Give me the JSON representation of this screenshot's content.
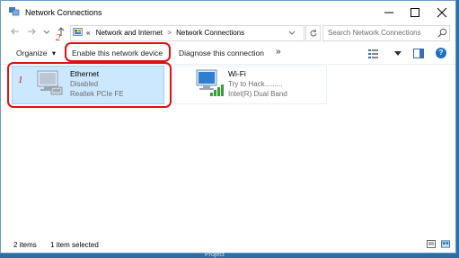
{
  "window": {
    "title": "Network Connections",
    "controls": {
      "minimize": "minimize-icon",
      "maximize": "maximize-icon",
      "close": "close-icon"
    }
  },
  "nav": {
    "back": "back-arrow-icon",
    "forward": "forward-arrow-icon",
    "recent": "chevron-down-icon",
    "up": "up-arrow-icon"
  },
  "address": {
    "overflow": "«",
    "crumbs": [
      "Network and Internet",
      "Network Connections"
    ],
    "separator": ">"
  },
  "search": {
    "placeholder": "Search Network Connections"
  },
  "toolbar": {
    "organize": "Organize",
    "organize_caret": "▾",
    "enable": "Enable this network device",
    "diagnose": "Diagnose this connection",
    "more": "»"
  },
  "adapters": [
    {
      "name": "Ethernet",
      "status": "Disabled",
      "device": "Realtek PCIe FE",
      "icon": "ethernet-adapter-icon",
      "selected": true
    },
    {
      "name": "Wi-Fi",
      "status": "Try to Hack.........",
      "device": "Intel(R) Dual Band",
      "icon": "wifi-adapter-icon",
      "selected": false
    }
  ],
  "annotations": {
    "one": "1",
    "two": "2",
    "color": "#dd1111"
  },
  "statusbar": {
    "items": "2 items",
    "selected": "1 item selected"
  },
  "taskbar": {
    "text": "Project"
  },
  "colors": {
    "selection": "#cce8ff",
    "selection_border": "#99d1ff",
    "help": "#1f6fc3"
  }
}
